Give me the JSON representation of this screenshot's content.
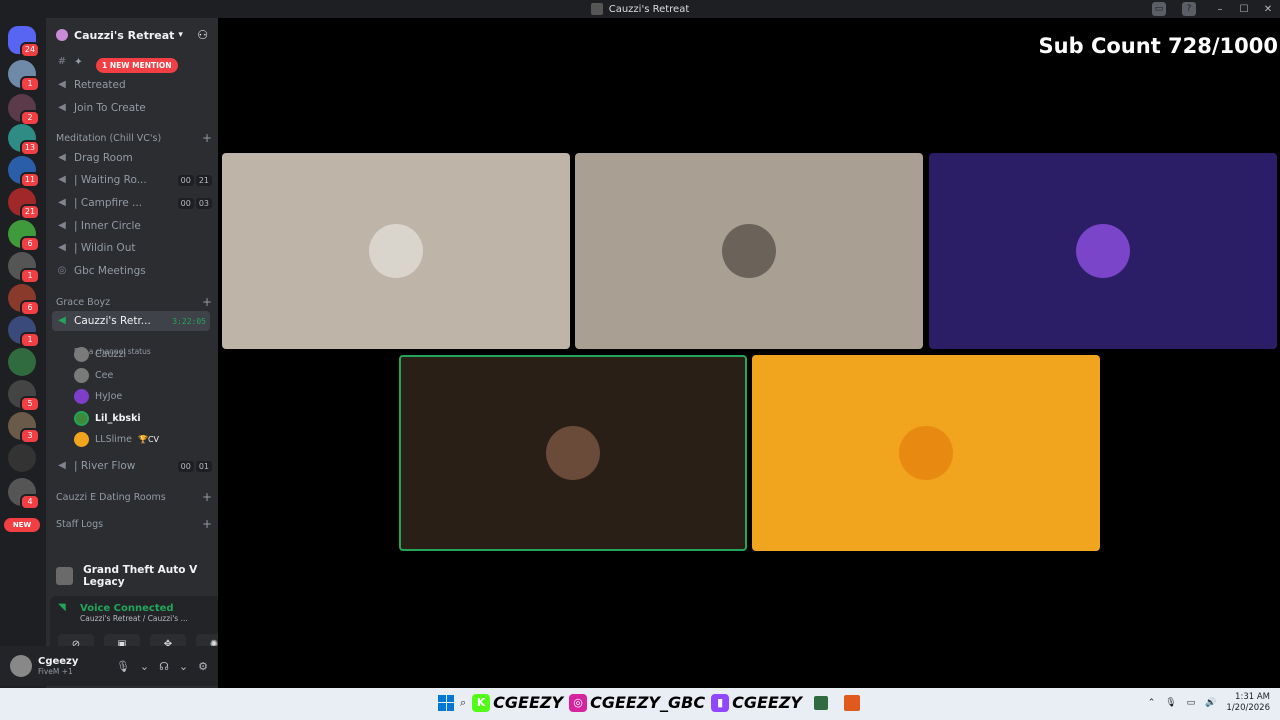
{
  "window": {
    "title": "Cauzzi's Retreat",
    "controls": [
      "–",
      "☐",
      "✕"
    ]
  },
  "guilds": [
    {
      "badge": "24"
    },
    {
      "badge": "1"
    },
    {
      "badge": "2"
    },
    {
      "badge": "13"
    },
    {
      "badge": "11"
    },
    {
      "badge": "21"
    },
    {
      "badge": "6"
    },
    {
      "badge": "1"
    },
    {
      "badge": "6"
    },
    {
      "badge": "1"
    },
    {
      "badge": ""
    },
    {
      "badge": "5"
    },
    {
      "badge": "3"
    },
    {
      "badge": ""
    },
    {
      "badge": "4"
    }
  ],
  "guild_new_label": "NEW",
  "server": {
    "name": "Cauzzi's Retreat",
    "mention_pill": "1 NEW MENTION"
  },
  "channels": {
    "top": [
      {
        "name": "",
        "icon": "#"
      },
      {
        "name": "Retreated",
        "icon": "🔊"
      },
      {
        "name": "Join To Create",
        "icon": "🔊"
      }
    ],
    "meditation_category": "Meditation (Chill VC's)",
    "meditation": [
      {
        "name": "Drag Room"
      },
      {
        "name": "| Waiting Ro...",
        "c1": "00",
        "c2": "21"
      },
      {
        "name": "| Campfire ...",
        "c1": "00",
        "c2": "03"
      },
      {
        "name": "| Inner Circle"
      },
      {
        "name": "| Wildin Out"
      },
      {
        "name": "Gbc Meetings"
      }
    ],
    "grace_category": "Grace Boyz",
    "active": {
      "name": "Cauzzi's Retr...",
      "timer": "3:22:05",
      "status": "Set a channel status"
    },
    "members": [
      {
        "name": "Cauzzi",
        "bold": false
      },
      {
        "name": "Cee",
        "bold": false
      },
      {
        "name": "HyJoe",
        "bold": false
      },
      {
        "name": "Lil_kbski",
        "bold": true
      },
      {
        "name": "LLSlime",
        "bold": false,
        "extra": "CV"
      }
    ],
    "river": {
      "name": "| River Flow",
      "c1": "00",
      "c2": "01"
    },
    "dating_category": "Cauzzi E Dating Rooms",
    "staff_category": "Staff Logs"
  },
  "game": {
    "name": "Grand Theft Auto V Legacy"
  },
  "voice": {
    "title": "Voice Connected",
    "subtitle": "Cauzzi's Retreat / Cauzzi's ..."
  },
  "user": {
    "name": "Cgeezy",
    "sub": "FiveM +1"
  },
  "stage": {
    "sub_count": "Sub Count 728/1000",
    "tiles": [
      {
        "bg": "#beb5a8",
        "avatar": "#d9d4cc"
      },
      {
        "bg": "#a9a093",
        "avatar": "#6b6259"
      },
      {
        "bg": "#2b1d66",
        "avatar": "#7a45c8"
      },
      {
        "bg": "#2a1f16",
        "avatar": "#6a4a38",
        "speaking": true
      },
      {
        "bg": "#f1a41d",
        "avatar": "#e88a12"
      }
    ]
  },
  "taskbar": {
    "socials": [
      {
        "icon": "K",
        "color": "#53fc18",
        "handle": "CGEEZY"
      },
      {
        "icon": "◎",
        "color": "#d6249f",
        "handle": "CGEEZY_GBC"
      },
      {
        "icon": "▮",
        "color": "#9146ff",
        "handle": "CGEEZY"
      }
    ],
    "time": "1:31 AM",
    "date": "1/20/2026"
  }
}
